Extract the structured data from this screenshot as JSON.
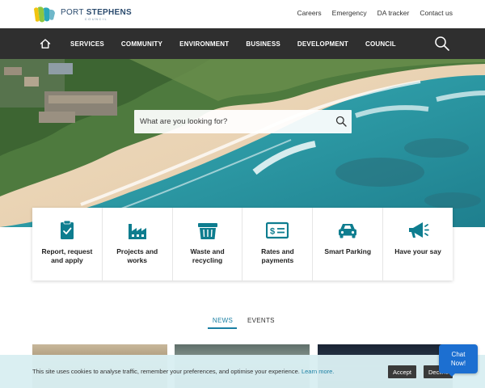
{
  "brand": {
    "name_light": "PORT ",
    "name_bold": "STEPHENS",
    "sub": "COUNCIL",
    "colors": {
      "green": "#8dc63f",
      "teal": "#2aa7b8",
      "blue": "#2b4b6e",
      "yellow": "#f1c40f"
    }
  },
  "utility_links": [
    "Careers",
    "Emergency",
    "DA tracker",
    "Contact us"
  ],
  "nav": {
    "home_icon": "home-icon",
    "items": [
      "SERVICES",
      "COMMUNITY",
      "ENVIRONMENT",
      "BUSINESS",
      "DEVELOPMENT",
      "COUNCIL"
    ],
    "search_icon": "search-icon"
  },
  "hero": {
    "search_placeholder": "What are you looking for?"
  },
  "tiles": [
    {
      "label": "Report, request and apply",
      "icon": "clipboard-check-icon"
    },
    {
      "label": "Projects and works",
      "icon": "factory-icon"
    },
    {
      "label": "Waste and recycling",
      "icon": "bin-icon"
    },
    {
      "label": "Rates and payments",
      "icon": "dollar-bill-icon"
    },
    {
      "label": "Smart Parking",
      "icon": "car-icon"
    },
    {
      "label": "Have your say",
      "icon": "megaphone-icon"
    }
  ],
  "tile_icon_color": "#0e7d8f",
  "tabs": {
    "news": "NEWS",
    "events": "EVENTS",
    "active": "news"
  },
  "cookie": {
    "text": "This site uses cookies to analyse traffic, remember your preferences, and optimise your experience.",
    "link": "Learn more.",
    "accept": "Accept",
    "decline": "Decline"
  },
  "chat": {
    "line1": "Chat",
    "line2": "Now!"
  }
}
